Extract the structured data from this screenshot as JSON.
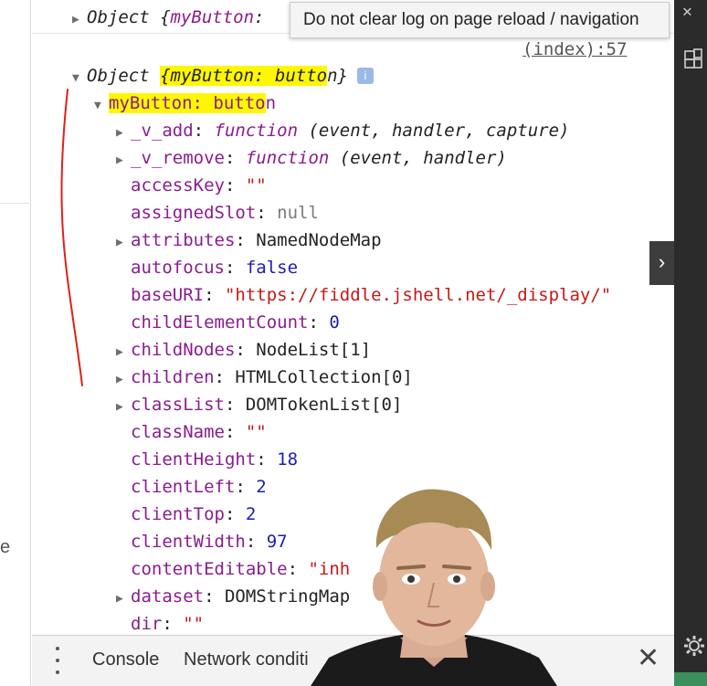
{
  "tooltip": {
    "text": "Do not clear log on page reload / navigation"
  },
  "source_link": "(index):57",
  "log": {
    "first_object": {
      "arrow": "▶",
      "prefix": "Object {",
      "key": "myButton"
    },
    "second_object": {
      "arrow": "▼",
      "prefix": "Object ",
      "highlight": "{myButton: butto",
      "rest": "n}",
      "info_icon": "i",
      "root": {
        "arrow": "▼",
        "highlight": "myButton: butto",
        "rest": "n"
      },
      "properties": [
        {
          "arrow": "▶",
          "key": "_v_add",
          "colon": ": ",
          "kw": "function",
          "value": " (event, handler, capture)",
          "type": "fn"
        },
        {
          "arrow": "▶",
          "key": "_v_remove",
          "colon": ": ",
          "kw": "function",
          "value": " (event, handler)",
          "type": "fn"
        },
        {
          "arrow": "",
          "key": "accessKey",
          "colon": ": ",
          "value": "\"\"",
          "type": "str"
        },
        {
          "arrow": "",
          "key": "assignedSlot",
          "colon": ": ",
          "value": "null",
          "type": "null"
        },
        {
          "arrow": "▶",
          "key": "attributes",
          "colon": ": ",
          "value": "NamedNodeMap",
          "type": "obj"
        },
        {
          "arrow": "",
          "key": "autofocus",
          "colon": ": ",
          "value": "false",
          "type": "kw"
        },
        {
          "arrow": "",
          "key": "baseURI",
          "colon": ": ",
          "value": "\"https://fiddle.jshell.net/_display/\"",
          "type": "str"
        },
        {
          "arrow": "",
          "key": "childElementCount",
          "colon": ": ",
          "value": "0",
          "type": "num"
        },
        {
          "arrow": "▶",
          "key": "childNodes",
          "colon": ": ",
          "value": "NodeList[1]",
          "type": "obj"
        },
        {
          "arrow": "▶",
          "key": "children",
          "colon": ": ",
          "value": "HTMLCollection[0]",
          "type": "obj"
        },
        {
          "arrow": "▶",
          "key": "classList",
          "colon": ": ",
          "value": "DOMTokenList[0]",
          "type": "obj"
        },
        {
          "arrow": "",
          "key": "className",
          "colon": ": ",
          "value": "\"\"",
          "type": "str"
        },
        {
          "arrow": "",
          "key": "clientHeight",
          "colon": ": ",
          "value": "18",
          "type": "num"
        },
        {
          "arrow": "",
          "key": "clientLeft",
          "colon": ": ",
          "value": "2",
          "type": "num"
        },
        {
          "arrow": "",
          "key": "clientTop",
          "colon": ": ",
          "value": "2",
          "type": "num"
        },
        {
          "arrow": "",
          "key": "clientWidth",
          "colon": ": ",
          "value": "97",
          "type": "num"
        },
        {
          "arrow": "",
          "key": "contentEditable",
          "colon": ": ",
          "value": "\"inh",
          "type": "str"
        },
        {
          "arrow": "▶",
          "key": "dataset",
          "colon": ": ",
          "value": "DOMStringMap",
          "type": "obj"
        },
        {
          "arrow": "",
          "key": "dir",
          "colon": ": ",
          "value": "\"\"",
          "type": "str"
        }
      ]
    }
  },
  "drawer": {
    "menu_icon": "kebab-menu-icon",
    "tabs": [
      {
        "label": "Console"
      },
      {
        "label": "Network conditi"
      }
    ],
    "tab_close": "×",
    "close": "✕"
  },
  "sidebar_edge": {
    "clipped_text": "e"
  },
  "right_panel": {
    "expand": "›",
    "top_close": "✕"
  },
  "colors": {
    "highlight": "#fff700",
    "key": "#8a1c8f",
    "string": "#c41a16",
    "number": "#1c1cb4",
    "annotation": "#e0201a"
  }
}
